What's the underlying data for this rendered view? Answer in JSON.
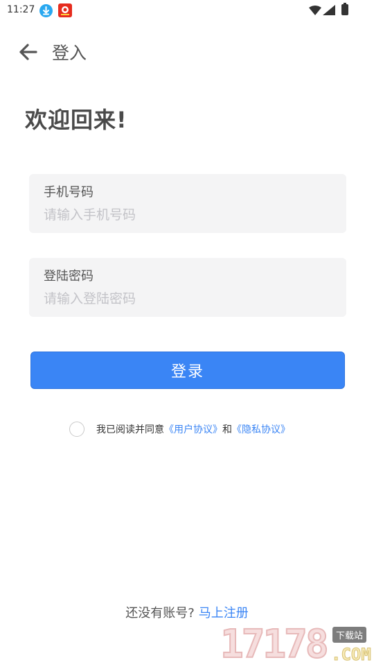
{
  "status_bar": {
    "time": "11:27"
  },
  "header": {
    "title": "登入"
  },
  "welcome": "欢迎回来!",
  "phone_field": {
    "label": "手机号码",
    "placeholder": "请输入手机号码",
    "value": ""
  },
  "password_field": {
    "label": "登陆密码",
    "placeholder": "请输入登陆密码",
    "value": ""
  },
  "login_button": "登录",
  "agreement": {
    "text_before": "我已阅读并同意",
    "user_agreement": "《用户协议》",
    "and": "和",
    "privacy_policy": "《隐私协议》",
    "checked": false
  },
  "footer": {
    "text": "还没有账号?",
    "register": "马上注册"
  },
  "watermark": {
    "digits": "17178",
    "tag": "下载站",
    "domain": ".COM"
  },
  "colors": {
    "accent": "#3a85f5",
    "field_bg": "#f4f4f5"
  },
  "icons": [
    "download-icon",
    "app-icon",
    "wifi-icon",
    "signal-icon",
    "battery-icon",
    "back-arrow-icon"
  ]
}
